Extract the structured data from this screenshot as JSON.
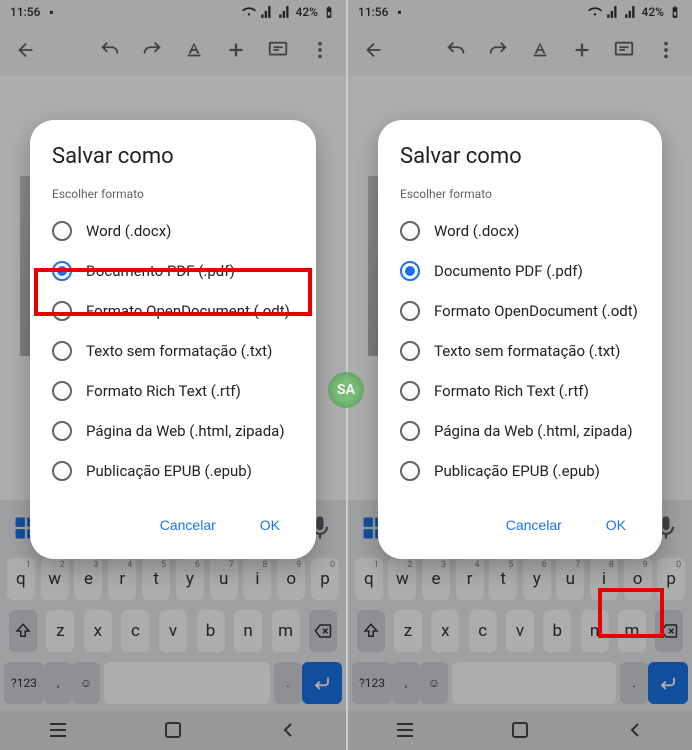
{
  "statusbar": {
    "time": "11:56",
    "battery": "42%"
  },
  "dialog": {
    "title": "Salvar como",
    "subtitle": "Escolher formato",
    "options": [
      {
        "label": "Word (.docx)",
        "selected": false
      },
      {
        "label": "Documento PDF (.pdf)",
        "selected": true
      },
      {
        "label": "Formato OpenDocument (.odt)",
        "selected": false
      },
      {
        "label": "Texto sem formatação (.txt)",
        "selected": false
      },
      {
        "label": "Formato Rich Text (.rtf)",
        "selected": false
      },
      {
        "label": "Página da Web (.html, zipada)",
        "selected": false
      },
      {
        "label": "Publicação EPUB (.epub)",
        "selected": false
      }
    ],
    "cancel": "Cancelar",
    "ok": "OK"
  },
  "keyboard": {
    "row1": [
      "q",
      "w",
      "e",
      "r",
      "t",
      "y",
      "u",
      "i",
      "o",
      "p"
    ],
    "row1sup": [
      "1",
      "2",
      "3",
      "4",
      "5",
      "6",
      "7",
      "8",
      "9",
      "0"
    ],
    "row3": [
      "z",
      "x",
      "c",
      "v",
      "b",
      "n",
      "m"
    ],
    "sym": "?123",
    "comma": ","
  },
  "watermark": "SA"
}
